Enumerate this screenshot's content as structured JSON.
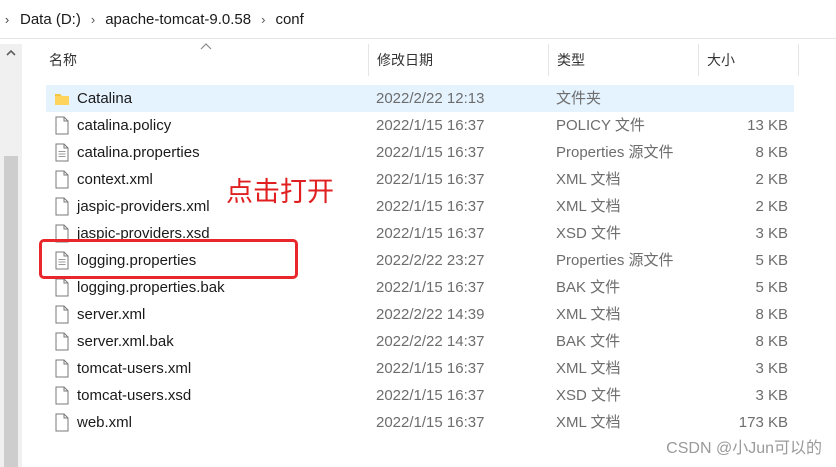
{
  "breadcrumb": {
    "items": [
      "Data (D:)",
      "apache-tomcat-9.0.58",
      "conf"
    ]
  },
  "columns": {
    "name": "名称",
    "date": "修改日期",
    "type": "类型",
    "size": "大小"
  },
  "files": [
    {
      "name": "Catalina",
      "date": "2022/2/22 12:13",
      "type": "文件夹",
      "size": "",
      "icon": "folder-icon",
      "selected": true
    },
    {
      "name": "catalina.policy",
      "date": "2022/1/15 16:37",
      "type": "POLICY 文件",
      "size": "13 KB",
      "icon": "file-icon"
    },
    {
      "name": "catalina.properties",
      "date": "2022/1/15 16:37",
      "type": "Properties 源文件",
      "size": "8 KB",
      "icon": "text-file-icon"
    },
    {
      "name": "context.xml",
      "date": "2022/1/15 16:37",
      "type": "XML 文档",
      "size": "2 KB",
      "icon": "file-icon"
    },
    {
      "name": "jaspic-providers.xml",
      "date": "2022/1/15 16:37",
      "type": "XML 文档",
      "size": "2 KB",
      "icon": "file-icon"
    },
    {
      "name": "jaspic-providers.xsd",
      "date": "2022/1/15 16:37",
      "type": "XSD 文件",
      "size": "3 KB",
      "icon": "file-icon"
    },
    {
      "name": "logging.properties",
      "date": "2022/2/22 23:27",
      "type": "Properties 源文件",
      "size": "5 KB",
      "icon": "text-file-icon"
    },
    {
      "name": "logging.properties.bak",
      "date": "2022/1/15 16:37",
      "type": "BAK 文件",
      "size": "5 KB",
      "icon": "file-icon"
    },
    {
      "name": "server.xml",
      "date": "2022/2/22 14:39",
      "type": "XML 文档",
      "size": "8 KB",
      "icon": "file-icon"
    },
    {
      "name": "server.xml.bak",
      "date": "2022/2/22 14:37",
      "type": "BAK 文件",
      "size": "8 KB",
      "icon": "file-icon"
    },
    {
      "name": "tomcat-users.xml",
      "date": "2022/1/15 16:37",
      "type": "XML 文档",
      "size": "3 KB",
      "icon": "file-icon"
    },
    {
      "name": "tomcat-users.xsd",
      "date": "2022/1/15 16:37",
      "type": "XSD 文件",
      "size": "3 KB",
      "icon": "file-icon"
    },
    {
      "name": "web.xml",
      "date": "2022/1/15 16:37",
      "type": "XML 文档",
      "size": "173 KB",
      "icon": "file-icon"
    }
  ],
  "annotation": {
    "text": "点击打开",
    "color": "#e02020"
  },
  "watermark": "CSDN @小Jun可以的",
  "colors": {
    "selection": "#e5f3ff",
    "folder": "#f4c542"
  }
}
